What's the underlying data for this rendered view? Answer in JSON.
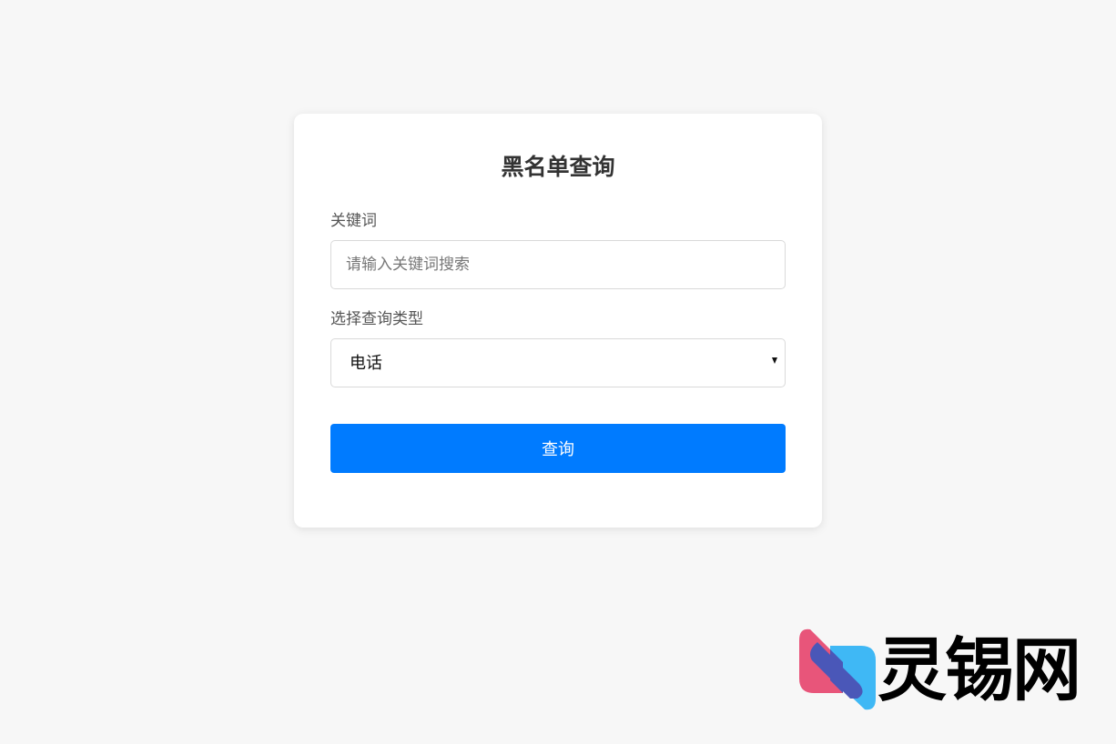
{
  "form": {
    "title": "黑名单查询",
    "keyword_label": "关键词",
    "keyword_placeholder": "请输入关键词搜索",
    "keyword_value": "",
    "type_label": "选择查询类型",
    "type_selected": "电话",
    "submit_label": "查询"
  },
  "watermark": {
    "text": "灵锡网"
  },
  "colors": {
    "background": "#f7f7f7",
    "card": "#ffffff",
    "primary": "#007bff",
    "logo_pink": "#e8557a",
    "logo_blue": "#3fb8f5",
    "logo_overlap": "#4a57b8"
  }
}
